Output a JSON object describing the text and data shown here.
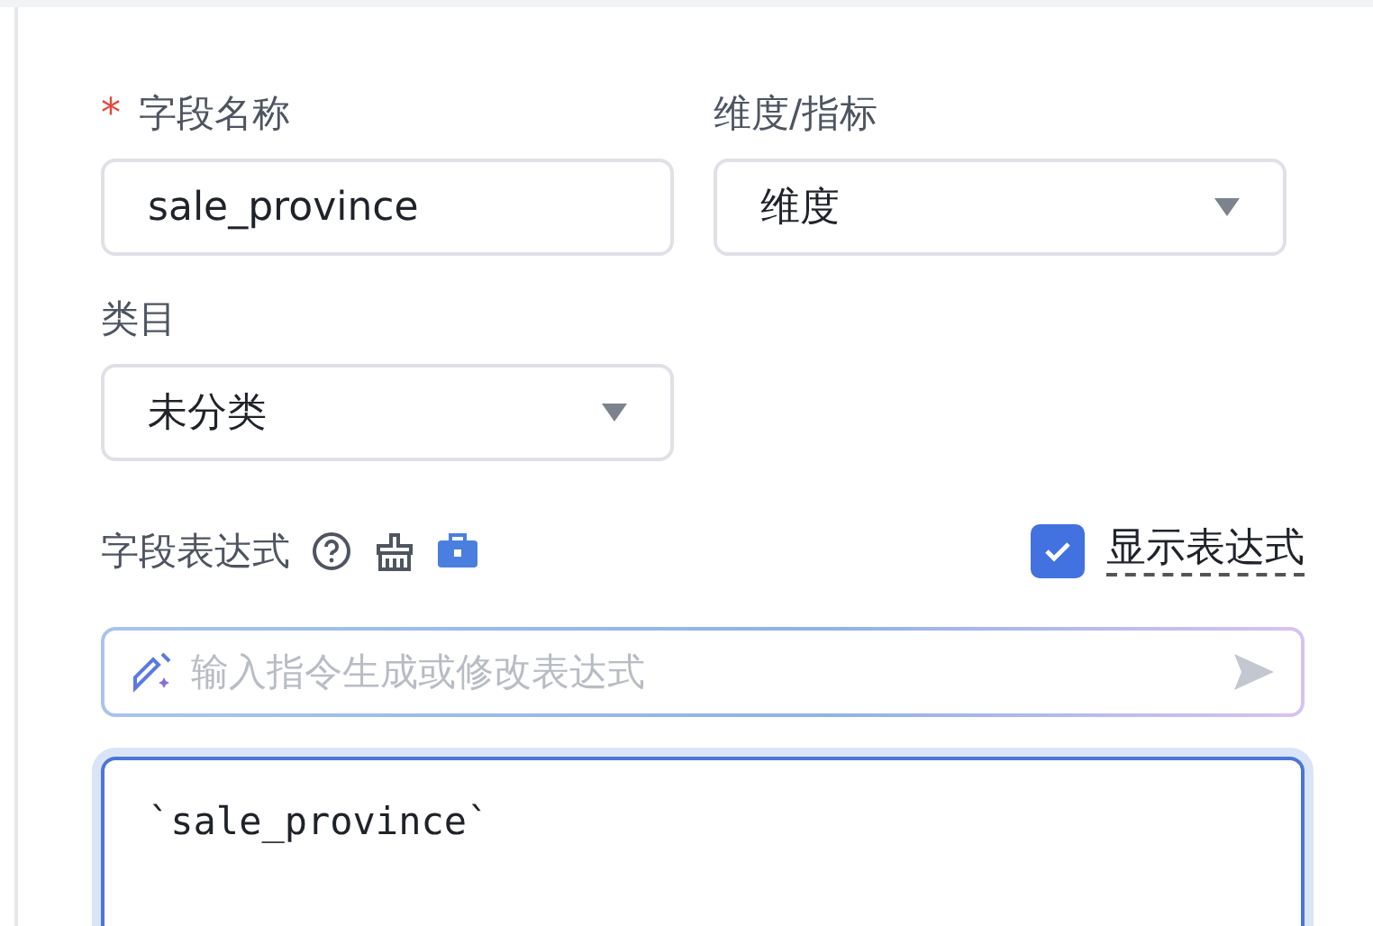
{
  "field_name": {
    "label": "字段名称",
    "required_mark": "*",
    "value": "sale_province"
  },
  "role": {
    "label": "维度/指标",
    "value": "维度"
  },
  "category": {
    "label": "类目",
    "value": "未分类"
  },
  "expression": {
    "label": "字段表达式",
    "show_expression": {
      "label": "显示表达式",
      "checked": true
    },
    "ai_prompt": {
      "placeholder": "输入指令生成或修改表达式"
    },
    "code": "`sale_province`"
  }
}
